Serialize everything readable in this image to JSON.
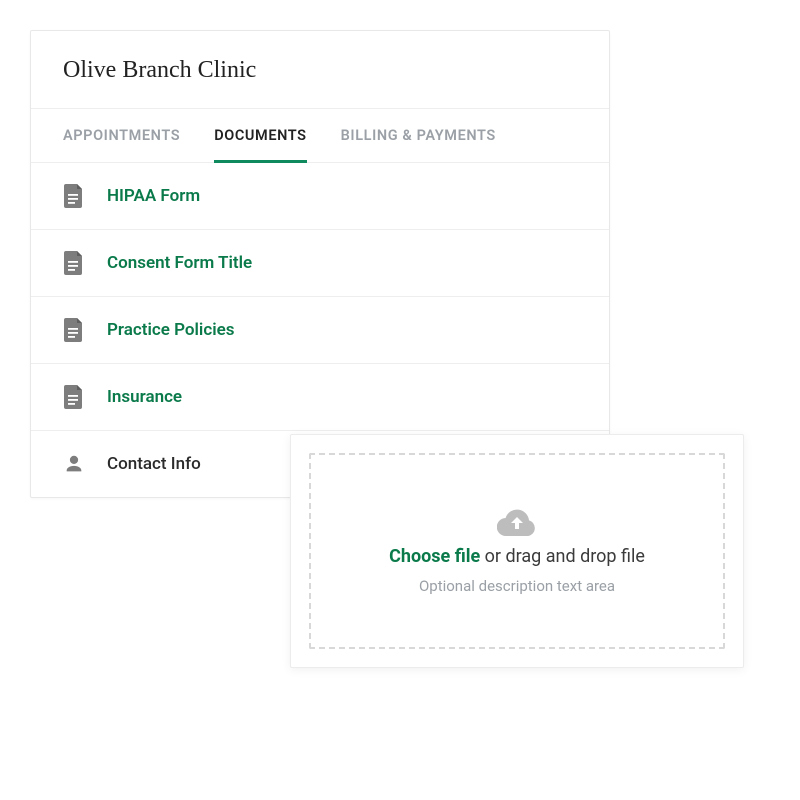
{
  "header": {
    "title": "Olive Branch Clinic"
  },
  "tabs": [
    {
      "label": "APPOINTMENTS",
      "active": false
    },
    {
      "label": "DOCUMENTS",
      "active": true
    },
    {
      "label": "BILLING & PAYMENTS",
      "active": false
    }
  ],
  "documents": [
    {
      "label": "HIPAA Form",
      "type": "doc"
    },
    {
      "label": "Consent Form Title",
      "type": "doc"
    },
    {
      "label": "Practice Policies",
      "type": "doc"
    },
    {
      "label": "Insurance",
      "type": "doc"
    },
    {
      "label": "Contact Info",
      "type": "contact"
    }
  ],
  "upload": {
    "strong": "Choose file",
    "rest": " or drag and drop file",
    "sub": "Optional description text area"
  },
  "colors": {
    "accent": "#0b7a4b",
    "icon_gray": "#7d7d7d",
    "muted_text": "#9aa0a6"
  }
}
